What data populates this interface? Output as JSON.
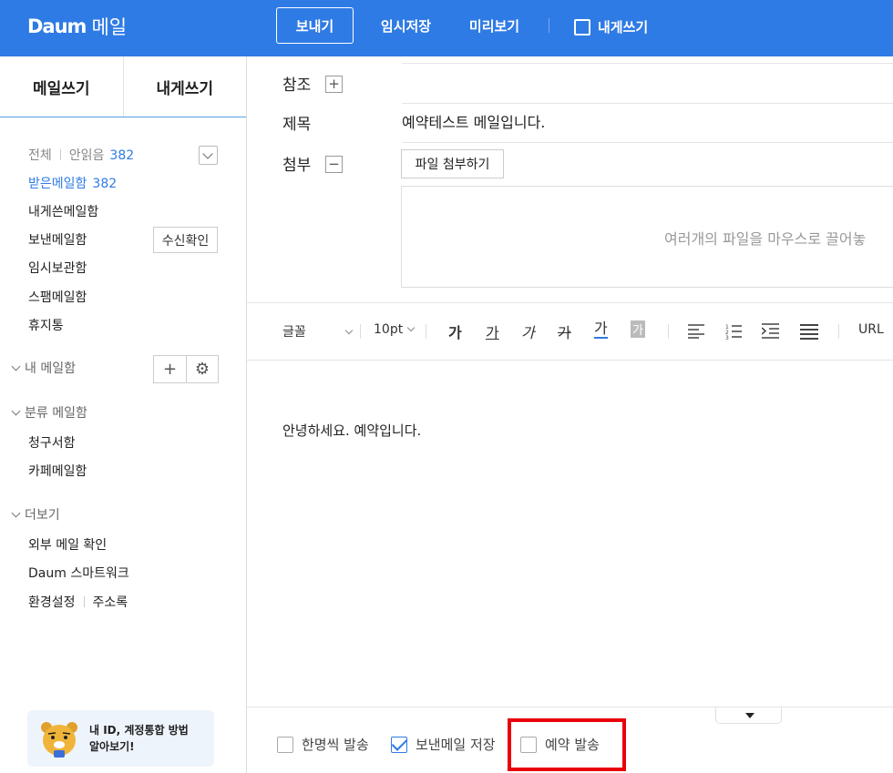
{
  "header": {
    "logo_brand": "Daum",
    "logo_service": "메일",
    "send_label": "보내기",
    "save_draft_label": "임시저장",
    "preview_label": "미리보기",
    "self_write_label": "내게쓰기"
  },
  "sidebar": {
    "tabs": [
      "메일쓰기",
      "내게쓰기"
    ],
    "filter_all": "전체",
    "filter_unread": "안읽음",
    "unread_count": "382",
    "inbox": {
      "label": "받은메일함",
      "count": "382"
    },
    "items": [
      "내게쓴메일함",
      "보낸메일함",
      "임시보관함",
      "스팸메일함",
      "휴지통"
    ],
    "receipt_button": "수신확인",
    "my_mailbox": "내 메일함",
    "category_mailbox": "분류 메일함",
    "category_items": [
      "청구서함",
      "카페메일함"
    ],
    "more": "더보기",
    "more_items": [
      "외부 메일 확인",
      "Daum 스마트워크"
    ],
    "settings": "환경설정",
    "address_book": "주소록",
    "promo": [
      "내 ID, 계정통합 방법",
      "알아보기!"
    ]
  },
  "compose": {
    "cc_label": "참조",
    "subject_label": "제목",
    "subject_value": "예약테스트 메일입니다.",
    "attach_label": "첨부",
    "attach_button": "파일 첨부하기",
    "dropzone_text": "여러개의 파일을 마우스로 끌어놓",
    "toolbar": {
      "font": "글꼴",
      "size": "10pt",
      "url": "URL"
    },
    "body": "안녕하세요. 예약입니다."
  },
  "options": {
    "individual_send": "한명씩 발송",
    "save_sent": "보낸메일 저장",
    "scheduled_send": "예약 발송"
  },
  "colors": {
    "brand_blue": "#2f7be5",
    "highlight_red": "#e8000b"
  }
}
